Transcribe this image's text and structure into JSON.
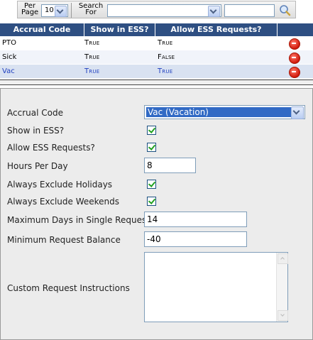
{
  "toolbar": {
    "per_page_label_1": "Per",
    "per_page_label_2": "Page",
    "per_page_value": "10",
    "search_label_1": "Search",
    "search_label_2": "For",
    "search_field_value": "",
    "search_text_value": "",
    "search_icon": "magnifier-icon"
  },
  "grid": {
    "headers": [
      "Accrual Code",
      "Show in ESS?",
      "Allow ESS Requests?",
      ""
    ],
    "rows": [
      {
        "code": "PTO",
        "show": "True",
        "allow": "True",
        "bg": "#ffffff",
        "color": "#000000"
      },
      {
        "code": "Sick",
        "show": "True",
        "allow": "False",
        "bg": "#f1f4fa",
        "color": "#000000"
      },
      {
        "code": "Vac",
        "show": "True",
        "allow": "True",
        "bg": "#d9e2f1",
        "color": "#1f3fbf"
      }
    ]
  },
  "form": {
    "accrual_code_label": "Accrual Code",
    "accrual_code_value": "Vac (Vacation)",
    "show_in_ess_label": "Show in ESS?",
    "show_in_ess_checked": true,
    "allow_ess_label": "Allow ESS Requests?",
    "allow_ess_checked": true,
    "hours_per_day_label": "Hours Per Day",
    "hours_per_day_value": "8",
    "exclude_holidays_label": "Always Exclude Holidays",
    "exclude_holidays_checked": true,
    "exclude_weekends_label": "Always Exclude Weekends",
    "exclude_weekends_checked": true,
    "max_days_label": "Maximum Days in Single Request",
    "max_days_value": "14",
    "min_balance_label": "Minimum Request Balance",
    "min_balance_value": "-40",
    "custom_instructions_label": "Custom Request Instructions",
    "custom_instructions_value": ""
  },
  "colors": {
    "header_bg": "#2e4f82",
    "selected_bg": "#316ac5",
    "panel_bg": "#ececec",
    "delete_icon": "#d21a0c",
    "check_green": "#21a121"
  }
}
